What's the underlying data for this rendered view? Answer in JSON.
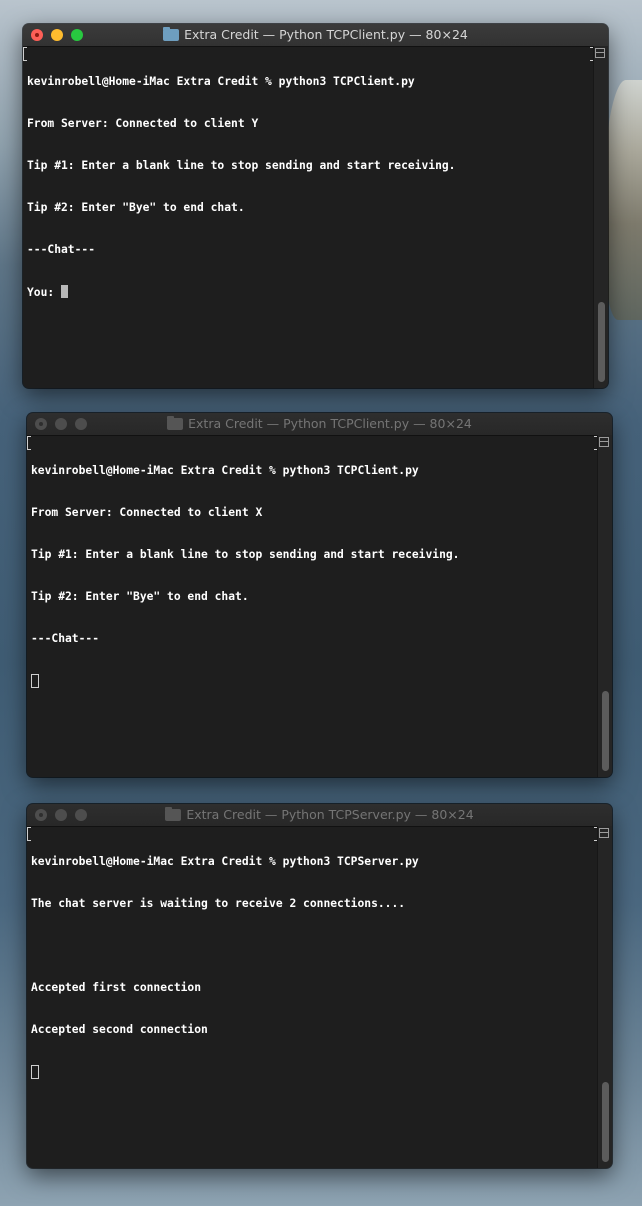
{
  "windows": [
    {
      "title": "Extra Credit — Python TCPClient.py — 80×24",
      "active": true,
      "lines": [
        "kevinrobell@Home-iMac Extra Credit % python3 TCPClient.py",
        "From Server: Connected to client Y",
        "Tip #1: Enter a blank line to stop sending and start receiving.",
        "Tip #2: Enter \"Bye\" to end chat.",
        "---Chat---",
        "You: "
      ],
      "cursor_style": "block"
    },
    {
      "title": "Extra Credit — Python TCPClient.py — 80×24",
      "active": false,
      "lines": [
        "kevinrobell@Home-iMac Extra Credit % python3 TCPClient.py",
        "From Server: Connected to client X",
        "Tip #1: Enter a blank line to stop sending and start receiving.",
        "Tip #2: Enter \"Bye\" to end chat.",
        "---Chat---",
        ""
      ],
      "cursor_style": "hollow"
    },
    {
      "title": "Extra Credit — Python TCPServer.py — 80×24",
      "active": false,
      "lines": [
        "kevinrobell@Home-iMac Extra Credit % python3 TCPServer.py",
        "The chat server is waiting to receive 2 connections....",
        "",
        "Accepted first connection",
        "Accepted second connection",
        ""
      ],
      "cursor_style": "hollow"
    }
  ],
  "colors": {
    "terminal_bg": "#1e1e1e",
    "terminal_text": "#ffffff",
    "close": "#fe5f57",
    "minimize": "#febc2e",
    "zoom": "#28c840"
  }
}
